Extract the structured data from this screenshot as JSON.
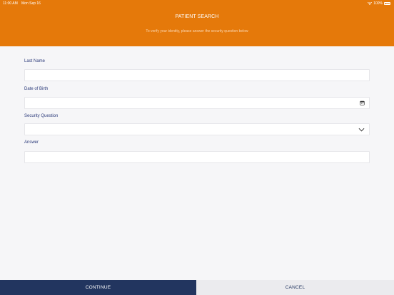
{
  "status_bar": {
    "time": "11:00 AM",
    "date": "Mon Sep 16",
    "battery": "100%"
  },
  "header": {
    "title": "PATIENT SEARCH",
    "subtitle": "To verify your identity, please answer the security question below"
  },
  "form": {
    "last_name": {
      "label": "Last Name",
      "value": ""
    },
    "date_of_birth": {
      "label": "Date of Birth",
      "value": ""
    },
    "security_question": {
      "label": "Security Question",
      "value": ""
    },
    "answer": {
      "label": "Answer",
      "value": ""
    }
  },
  "footer": {
    "continue_label": "CONTINUE",
    "cancel_label": "CANCEL"
  },
  "colors": {
    "header": "#e5790a",
    "primary_button": "#22355f",
    "label": "#2b3a7a"
  }
}
